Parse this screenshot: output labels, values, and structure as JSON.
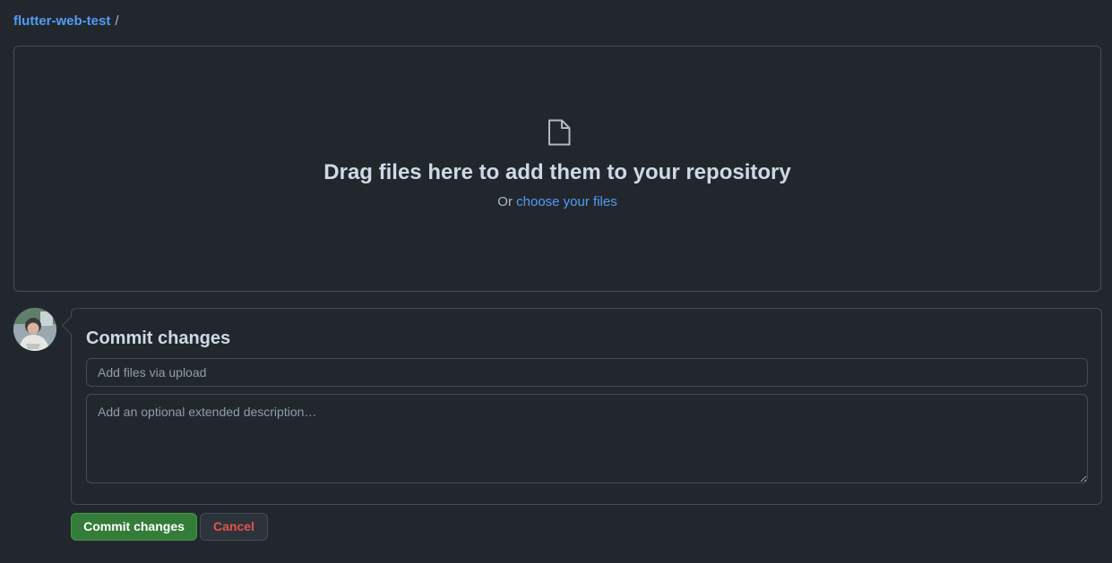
{
  "breadcrumb": {
    "repo": "flutter-web-test",
    "separator": "/"
  },
  "dropzone": {
    "icon": "file-icon",
    "title": "Drag files here to add them to your repository",
    "prefix": "Or",
    "choose_link": "choose your files"
  },
  "commit": {
    "avatar_icon": "user-avatar",
    "title": "Commit changes",
    "summary_placeholder": "Add files via upload",
    "summary_value": "",
    "description_placeholder": "Add an optional extended description…",
    "description_value": ""
  },
  "actions": {
    "commit_label": "Commit changes",
    "cancel_label": "Cancel"
  },
  "colors": {
    "background": "#22272e",
    "border": "#444c56",
    "link": "#539bf5",
    "primary_button": "#347d39",
    "danger_text": "#e5534b"
  }
}
